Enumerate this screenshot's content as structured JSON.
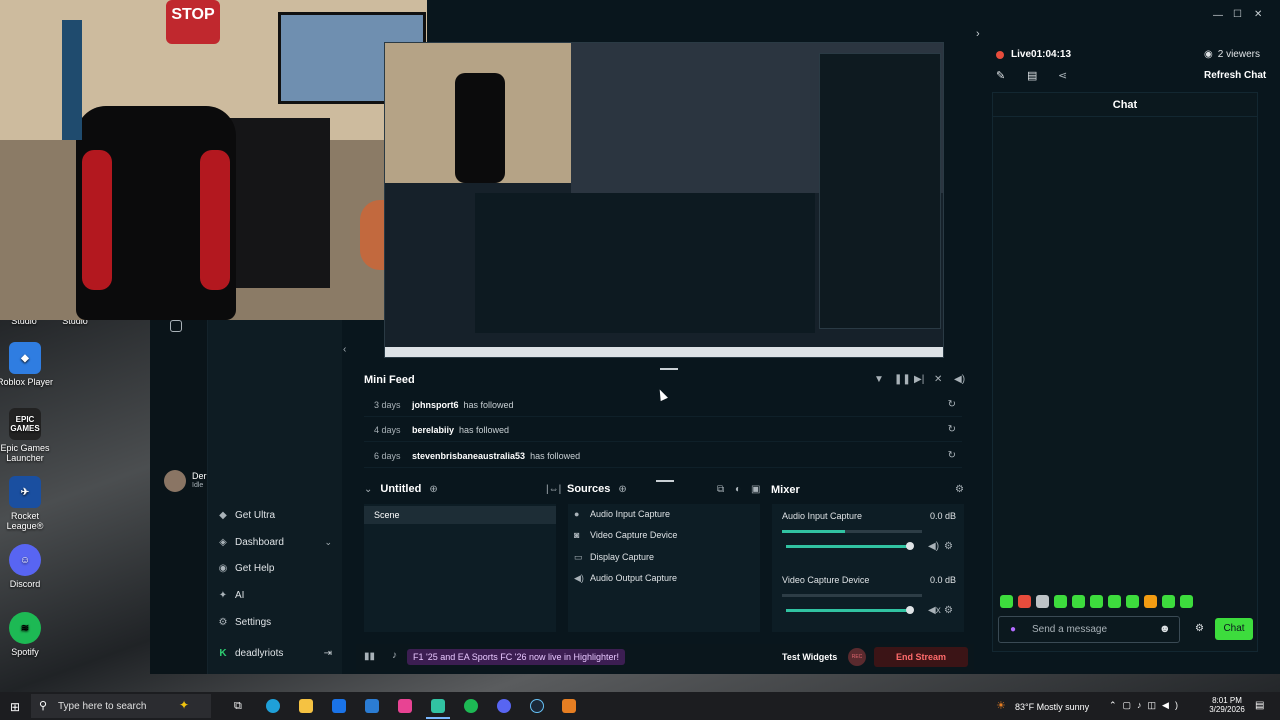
{
  "desktop": {
    "icons": [
      {
        "label": "Studio"
      },
      {
        "label": "Studio"
      },
      {
        "label": "Roblox Player"
      },
      {
        "label": "Epic Games Launcher"
      },
      {
        "label": "Rocket League®"
      },
      {
        "label": "Discord"
      },
      {
        "label": "Spotify"
      }
    ],
    "epic_logo": "EPIC GAMES"
  },
  "webcam": {
    "sign_text": "STOP"
  },
  "window": {
    "controls": {
      "minimize": "—",
      "maximize": "☐",
      "close": "✕"
    }
  },
  "user": {
    "name": "Der",
    "status": "Idle"
  },
  "nav": {
    "items": [
      {
        "label": "Get Ultra",
        "icon": "ultra-icon"
      },
      {
        "label": "Dashboard",
        "icon": "dashboard-icon"
      },
      {
        "label": "Get Help",
        "icon": "help-icon"
      },
      {
        "label": "AI",
        "icon": "ai-icon"
      },
      {
        "label": "Settings",
        "icon": "gear-icon"
      }
    ],
    "account": "deadlyriots"
  },
  "minifeed": {
    "title": "Mini Feed",
    "rows": [
      {
        "when": "3 days",
        "user": "johnsport6",
        "action": "has followed"
      },
      {
        "when": "4 days",
        "user": "berelabiiy",
        "action": "has followed"
      },
      {
        "when": "6 days",
        "user": "stevenbrisbaneaustralia53",
        "action": "has followed"
      }
    ]
  },
  "scenes": {
    "title": "Untitled",
    "items": [
      "Scene"
    ]
  },
  "sources": {
    "title": "Sources",
    "items": [
      {
        "label": "Audio Input Capture",
        "icon": "microphone-icon"
      },
      {
        "label": "Video Capture Device",
        "icon": "camera-icon"
      },
      {
        "label": "Display Capture",
        "icon": "monitor-icon"
      },
      {
        "label": "Audio Output Capture",
        "icon": "speaker-icon"
      }
    ]
  },
  "mixer": {
    "title": "Mixer",
    "channels": [
      {
        "name": "Audio Input Capture",
        "db": "0.0 dB",
        "level": 0.45,
        "volume": 1.0
      },
      {
        "name": "Video Capture Device",
        "db": "0.0 dB",
        "level": 0.0,
        "volume": 1.0
      }
    ]
  },
  "footer": {
    "promo": "F1 '25 and EA Sports FC '26 now live in Highlighter!",
    "test_widgets": "Test Widgets",
    "rec": "REC",
    "end_stream": "End Stream"
  },
  "live": {
    "status": "Live",
    "time": "01:04:13",
    "viewers": "2 viewers",
    "refresh": "Refresh Chat",
    "chat_title": "Chat",
    "chat_placeholder": "Send a message",
    "chat_button": "Chat"
  },
  "taskbar": {
    "search_placeholder": "Type here to search",
    "weather": "83°F  Mostly sunny",
    "time": "8:01 PM",
    "date": "3/29/2026"
  },
  "colors": {
    "accent": "#31c3a2",
    "live_red": "#e74c3c",
    "chat_green": "#3ddc3d",
    "brand_green": "#2ecc71"
  }
}
